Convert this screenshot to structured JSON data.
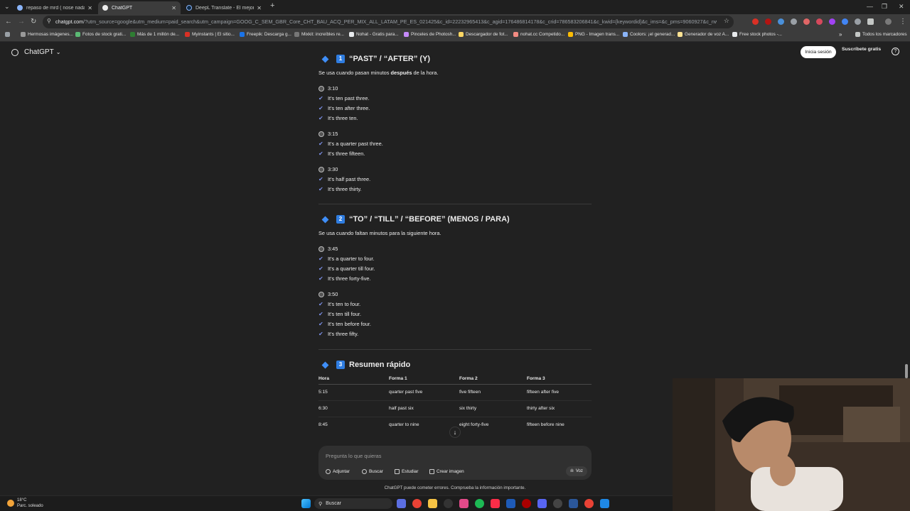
{
  "browser": {
    "tabs": [
      {
        "title": "repaso de mrd ( nose nada) - F",
        "active": false,
        "color": "#8ab4f8"
      },
      {
        "title": "ChatGPT",
        "active": true,
        "color": "#ececec"
      },
      {
        "title": "DeepL Translate - El mejor trad",
        "active": false,
        "color": "#0f2b46"
      }
    ],
    "new_tab": "+",
    "window_controls": [
      "—",
      "❐",
      "✕"
    ],
    "url_host": "chatgpt.com",
    "url_rest": "/?utm_source=google&utm_medium=paid_search&utm_campaign=GOOG_C_SEM_GBR_Core_CHT_BAU_ACQ_PER_MIX_ALL_LATAM_PE_ES_021425&c_id=22232965413&c_agid=176486814178&c_crid=786583206841&c_kwid={keywordid}&c_ims=&c_pms=9060927&c_nw=g&c_dvc=c&gad_so...",
    "bookmarks": [
      {
        "label": "Hermosas imágenes...",
        "color": "#999"
      },
      {
        "label": "Fotos de stock grati...",
        "color": "#5bb974"
      },
      {
        "label": "Más de 1 millón de...",
        "color": "#2e7d32"
      },
      {
        "label": "Myinstants | El sitio...",
        "color": "#d93025"
      },
      {
        "label": "Freepik: Descarga g...",
        "color": "#1a73e8"
      },
      {
        "label": "Mixkit: increíbles re...",
        "color": "#777"
      },
      {
        "label": "Nohat - Gratis para...",
        "color": "#e8eaed"
      },
      {
        "label": "Pinceles de Photosh...",
        "color": "#c58af9"
      },
      {
        "label": "Descargador de fot...",
        "color": "#fdd663"
      },
      {
        "label": "nohat.cc Competido...",
        "color": "#f28b82"
      },
      {
        "label": "PNG - Imagen trans...",
        "color": "#fbbc04"
      },
      {
        "label": "Coolors: ¡el generad...",
        "color": "#8ab4f8"
      },
      {
        "label": "Generador de voz A...",
        "color": "#fde293"
      },
      {
        "label": "Free stock photos -...",
        "color": "#e8eaed"
      }
    ],
    "bookmarks_overflow": "»",
    "all_bookmarks": "Todos los marcadores"
  },
  "app": {
    "name": "ChatGPT",
    "login": "Inicia sesión",
    "subscribe": "Suscríbete gratis",
    "help": "?"
  },
  "sections": {
    "past": {
      "num": "1",
      "title": "“PAST” / “AFTER” (Y)",
      "desc_before": "Se usa cuando pasan minutos ",
      "desc_bold": "después",
      "desc_after": " de la hora.",
      "groups": [
        {
          "time": "3:10",
          "items": [
            "It's ten past three.",
            "It's ten after three.",
            "It's three ten."
          ]
        },
        {
          "time": "3:15",
          "items": [
            "It's a quarter past three.",
            "It's three fifteen."
          ]
        },
        {
          "time": "3:30",
          "items": [
            "It's half past three.",
            "It's three thirty."
          ]
        }
      ]
    },
    "to": {
      "num": "2",
      "title": "“TO” / “TILL” / “BEFORE” (MENOS / PARA)",
      "desc": "Se usa cuando faltan minutos para la siguiente hora.",
      "groups": [
        {
          "time": "3:45",
          "items": [
            "It's a quarter to four.",
            "It's a quarter till four.",
            "It's three forty-five."
          ]
        },
        {
          "time": "3:50",
          "items": [
            "It's ten to four.",
            "It's ten till four.",
            "It's ten before four.",
            "It's three fifty."
          ]
        }
      ]
    },
    "summary": {
      "num": "3",
      "title": "Resumen rápido",
      "headers": [
        "Hora",
        "Forma 1",
        "Forma 2",
        "Forma 3"
      ],
      "rows": [
        [
          "5:15",
          "quarter past five",
          "five fifteen",
          "fifteen after five"
        ],
        [
          "6:30",
          "half past six",
          "six thirty",
          "thirty after six"
        ],
        [
          "8:45",
          "quarter to nine",
          "eight forty-five",
          "fifteen before nine"
        ]
      ]
    }
  },
  "composer": {
    "placeholder": "Pregunta lo que quieras",
    "attach": "Adjuntar",
    "search": "Buscar",
    "study": "Estudiar",
    "image": "Crear imagen",
    "voice": "Voz"
  },
  "disclaimer": "ChatGPT puede cometer errores. Comprueba la información importante.",
  "taskbar": {
    "temp": "18°C",
    "weather": "Parc. soleado",
    "search": "Buscar"
  }
}
